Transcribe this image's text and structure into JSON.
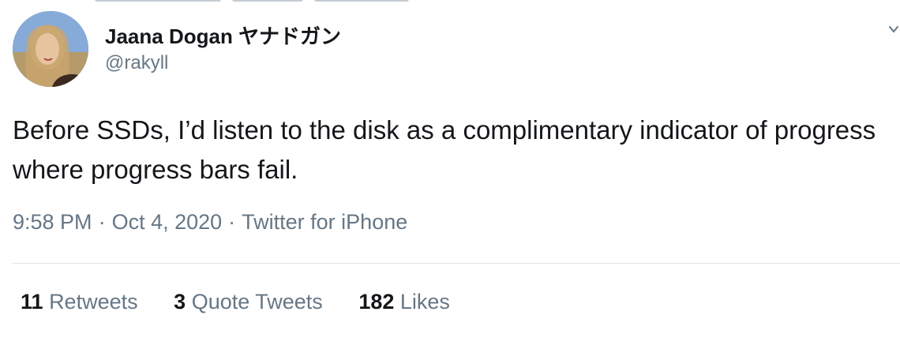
{
  "tweet": {
    "author": {
      "display_name": "Jaana Dogan ヤナドガン",
      "handle": "@rakyll"
    },
    "text": "Before SSDs, I’d listen to the disk as a complimentary indicator of progress where progress bars fail.",
    "meta": {
      "time": "9:58 PM",
      "separator": "·",
      "date": "Oct 4, 2020",
      "source": "Twitter for iPhone"
    },
    "stats": [
      {
        "count": "11",
        "label": "Retweets"
      },
      {
        "count": "3",
        "label": "Quote Tweets"
      },
      {
        "count": "182",
        "label": "Likes"
      }
    ]
  },
  "icons": {
    "menu": "chevron-down-icon"
  },
  "colors": {
    "text_primary": "#14171a",
    "text_secondary": "#657786",
    "divider": "#e1e8ed"
  }
}
